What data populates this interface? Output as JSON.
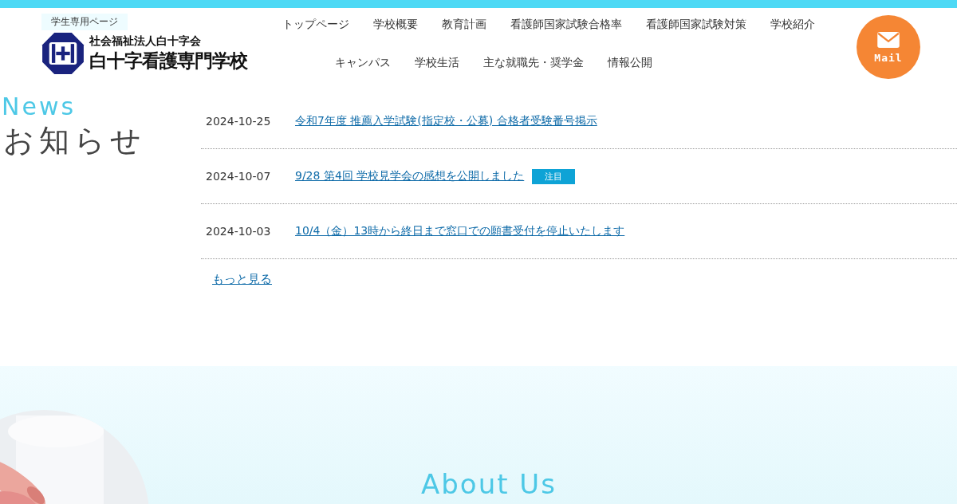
{
  "header": {
    "student_page_link": "学生専用ページ",
    "org_name": "社会福祉法人白十字会",
    "school_name": "白十字看護専門学校",
    "nav": [
      {
        "label": "トップページ"
      },
      {
        "label": "学校概要"
      },
      {
        "label": "教育計画"
      },
      {
        "label": "看護師国家試験合格率"
      },
      {
        "label": "看護師国家試験対策"
      },
      {
        "label": "学校紹介"
      },
      {
        "label": "キャンパス"
      },
      {
        "label": "学校生活"
      },
      {
        "label": "主な就職先・奨学金"
      },
      {
        "label": "情報公開"
      }
    ],
    "mail_button": "Mail"
  },
  "news": {
    "heading_en": "News",
    "heading": "お知らせ",
    "items": [
      {
        "date": "2024-10-25",
        "title": "令和7年度 推薦入学試験(指定校・公募) 合格者受験番号掲示"
      },
      {
        "date": "2024-10-07",
        "title": "9/28 第4回 学校見学会の感想を公開しました",
        "badge": "注目"
      },
      {
        "date": "2024-10-03",
        "title": "10/4（金）13時から終日まで窓口での願書受付を停止いたします"
      }
    ],
    "more_link": "もっと見る"
  },
  "about": {
    "heading": "About Us"
  }
}
